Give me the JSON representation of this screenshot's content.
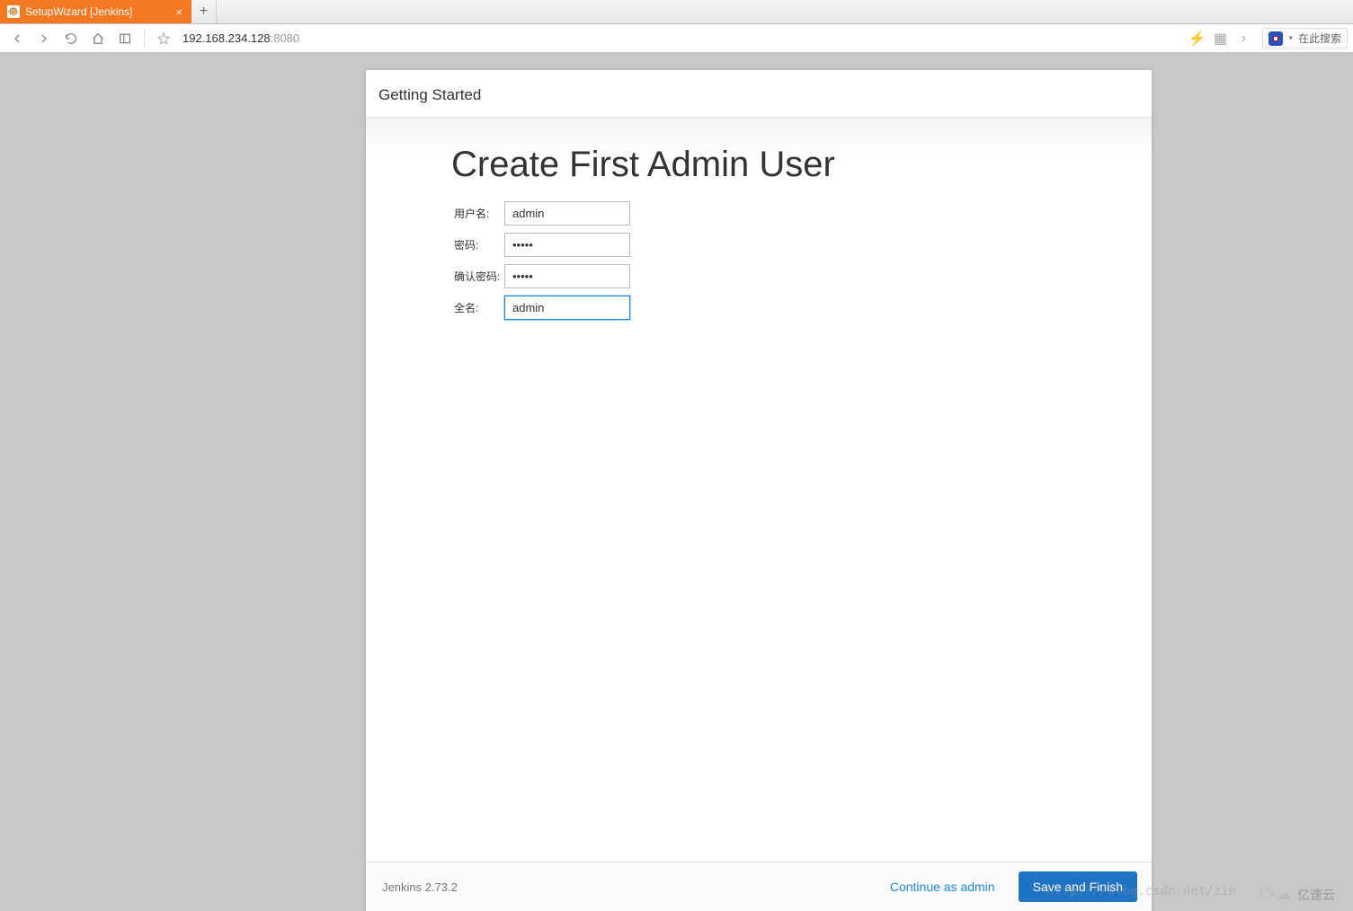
{
  "browser": {
    "tab_title": "SetupWizard [Jenkins]",
    "url_host": "192.168.234.128",
    "url_port": ":8080",
    "search_placeholder": "在此搜索"
  },
  "modal": {
    "header": "Getting Started",
    "title": "Create First Admin User",
    "fields": {
      "username": {
        "label": "用户名:",
        "value": "admin"
      },
      "password": {
        "label": "密码:",
        "value": "•••••"
      },
      "confirm": {
        "label": "确认密码:",
        "value": "•••••"
      },
      "fullname": {
        "label": "全名:",
        "value": "admin"
      }
    },
    "footer": {
      "version": "Jenkins 2.73.2",
      "continue": "Continue as admin",
      "save": "Save and Finish"
    }
  },
  "watermark": {
    "brand": "亿速云",
    "url": "https://blog.csdn.net/zin"
  }
}
